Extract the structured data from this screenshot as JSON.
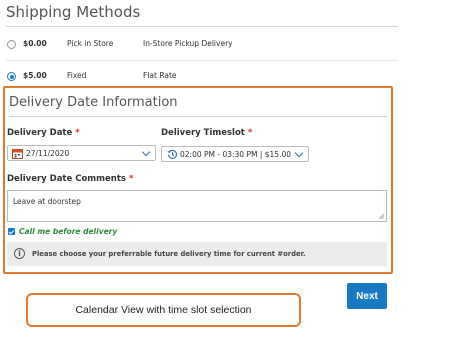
{
  "shipping": {
    "title": "Shipping Methods",
    "methods": [
      {
        "price": "$0.00",
        "method": "Pick in Store",
        "carrier": "In-Store Pickup Delivery",
        "selected": false
      },
      {
        "price": "$5.00",
        "method": "Fixed",
        "carrier": "Flat Rate",
        "selected": true
      }
    ]
  },
  "delivery": {
    "title": "Delivery Date Information",
    "date_label": "Delivery Date",
    "date_value": "27/11/2020",
    "timeslot_label": "Delivery Timeslot",
    "timeslot_value": "02:00 PM - 03:30 PM | $15.00",
    "comments_label": "Delivery Date Comments",
    "comments_value": "Leave at doorstep",
    "required_mark": "*",
    "call_me_label": "Call me before delivery",
    "call_me_checked": true,
    "notice": "Please choose your preferrable future delivery time for current #order."
  },
  "callout": {
    "text": "Calendar View with time slot selection"
  },
  "actions": {
    "next_label": "Next"
  },
  "colors": {
    "accent": "#1979c3",
    "highlight": "#e07b30",
    "required": "#e02b27",
    "call_me": "#2b8a3e"
  },
  "icons": {
    "date": "calendar-icon",
    "timeslot": "clock-history-icon",
    "notice": "info-icon",
    "dropdown": "chevron-down-icon"
  }
}
